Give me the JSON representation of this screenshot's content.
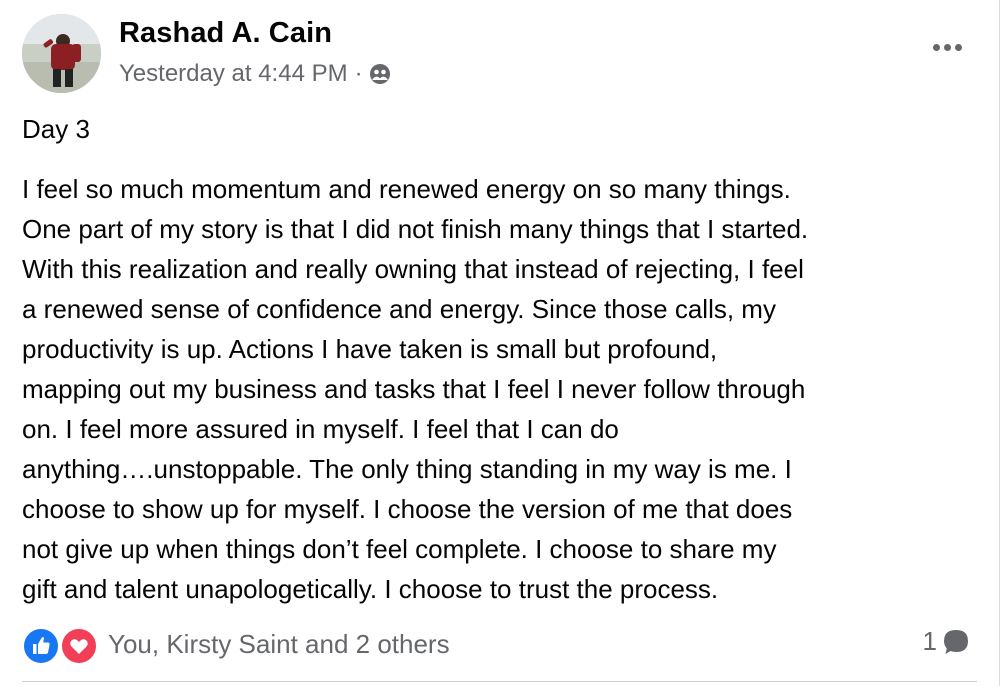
{
  "post": {
    "author": "Rashad A. Cain",
    "timestamp": "Yesterday at 4:44 PM",
    "separator": "·",
    "audience_icon": "friends-icon",
    "more_icon": "more-options-icon",
    "title": "Day 3",
    "body_lines": [
      "I feel so much momentum and renewed energy on so many things.",
      "One part of my story is that I did not finish many things that I started.",
      "With this realization and really owning that instead of rejecting, I feel",
      "a renewed sense of confidence and energy. Since those calls, my",
      "productivity is up. Actions I have taken is small but profound,",
      "mapping out my business and tasks that I feel I never follow through",
      "on. I feel more assured in myself. I feel that I can do",
      "anything….unstoppable. The only thing standing in my way is me. I",
      "choose to show up for myself. I choose the version of me that does",
      "not give up when things don’t feel complete. I choose to share my",
      "gift and talent unapologetically. I choose to trust the process."
    ]
  },
  "footer": {
    "reactions_text": "You, Kirsty Saint and 2 others",
    "reaction_icons": [
      "like-icon",
      "love-icon"
    ],
    "comment_count": "1",
    "comment_icon": "comment-icon"
  },
  "colors": {
    "text_primary": "#050505",
    "text_secondary": "#65676b",
    "like_blue": "#1877f2",
    "love_red": "#f33e58",
    "divider": "#ced0d4"
  }
}
